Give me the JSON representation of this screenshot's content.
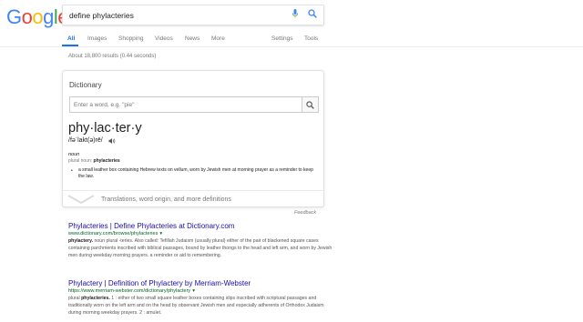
{
  "logo": {
    "letters": [
      {
        "char": "G",
        "color": "#4285F4"
      },
      {
        "char": "o",
        "color": "#EA4335"
      },
      {
        "char": "o",
        "color": "#FBBC05"
      },
      {
        "char": "g",
        "color": "#4285F4"
      },
      {
        "char": "l",
        "color": "#34A853"
      },
      {
        "char": "e",
        "color": "#EA4335"
      }
    ]
  },
  "search": {
    "query": "define phylacteries",
    "mic_icon": "mic-icon",
    "search_icon": "search-icon"
  },
  "tabs": [
    {
      "label": "All",
      "active": true
    },
    {
      "label": "Images"
    },
    {
      "label": "Shopping"
    },
    {
      "label": "Videos"
    },
    {
      "label": "News"
    },
    {
      "label": "More"
    }
  ],
  "tools": {
    "settings": "Settings",
    "tools": "Tools"
  },
  "stats": "About 18,800 results (0.44 seconds)",
  "dictionary": {
    "title": "Dictionary",
    "search_placeholder": "Enter a word, e.g. \"pie\"",
    "headword": "phy·lac·ter·y",
    "pronunciation": "/fəˈlakt(ə)rē/",
    "speaker_icon": "speaker-icon",
    "part_of_speech": "noun",
    "plural_label": "plural noun:",
    "plural_form": "phylacteries",
    "definition": "a small leather box containing Hebrew texts on vellum, worn by Jewish men at morning prayer as a reminder to keep the law.",
    "more_label": "Translations, word origin, and more definitions"
  },
  "feedback": "Feedback",
  "results": [
    {
      "title": "Phylacteries | Define Phylacteries at Dictionary.com",
      "url": "www.dictionary.com/browse/phylacteries",
      "snippet_bold": "phylactery.",
      "snippet": " noun plural -teries. Also called: Tefillah Judaism (usually plural) either of the pair of blackened square cases containing parchments inscribed with biblical passages, bound by leather thongs to the head and left arm, and worn by Jewish men during weekday morning prayers. a reminder or aid to remembering."
    },
    {
      "title": "Phylactery | Definition of Phylactery by Merriam-Webster",
      "url": "https://www.merriam-webster.com/dictionary/phylactery",
      "snippet_bold": "phylacteries.",
      "snippet_prefix": "plural ",
      "snippet": " 1 : either of two small square leather boxes containing slips inscribed with scriptural passages and traditionally worn on the left arm and on the head by observant Jewish men and especially adherents of Orthodox Judaism during morning weekday prayers. 2 : amulet."
    }
  ]
}
